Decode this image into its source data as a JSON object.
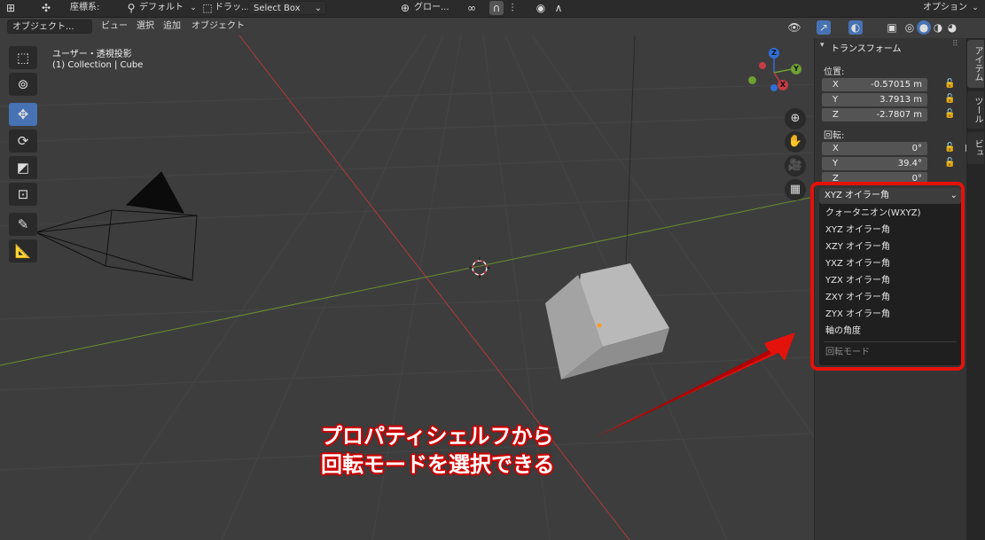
{
  "header": {
    "coord_label": "座標系:",
    "orientation_value": "デフォルト",
    "drag_label": "ドラッ...",
    "select_mode": "Select Box",
    "pivot_value": "グロー...",
    "options_label": "オプション"
  },
  "menu": {
    "mode_select": "オブジェクト...",
    "items": [
      "ビュー",
      "選択",
      "追加",
      "オブジェクト"
    ]
  },
  "viewport": {
    "view_name": "ユーザー・透視投影",
    "collection_info": "(1) Collection | Cube"
  },
  "gizmo": {
    "x": "X",
    "y": "Y",
    "z": "Z"
  },
  "npanel": {
    "section_title": "トランスフォーム",
    "location_label": "位置:",
    "location": [
      {
        "axis": "X",
        "value": "-0.57015 m"
      },
      {
        "axis": "Y",
        "value": "3.7913 m"
      },
      {
        "axis": "Z",
        "value": "-2.7807 m"
      }
    ],
    "rotation_label": "回転:",
    "rotation": [
      {
        "axis": "X",
        "value": "0°"
      },
      {
        "axis": "Y",
        "value": "39.4°"
      },
      {
        "axis": "Z",
        "value": "0°"
      }
    ],
    "tabs": [
      "アイテム",
      "ツール",
      "ビュー"
    ]
  },
  "dropdown": {
    "current": "XYZ オイラー角",
    "options": [
      "クォータニオン(WXYZ)",
      "XYZ オイラー角",
      "XZY オイラー角",
      "YXZ オイラー角",
      "YZX オイラー角",
      "ZXY オイラー角",
      "ZYX オイラー角",
      "軸の角度"
    ],
    "footer": "回転モード"
  },
  "annotation": {
    "line1": "プロパティシェルフから",
    "line2": "回転モードを選択できる"
  },
  "colors": {
    "highlight_red": "#e3120b",
    "active_tool": "#4772b3",
    "x_axis": "#c43c45",
    "y_axis": "#6ea032",
    "z_axis": "#2f6fd8"
  }
}
